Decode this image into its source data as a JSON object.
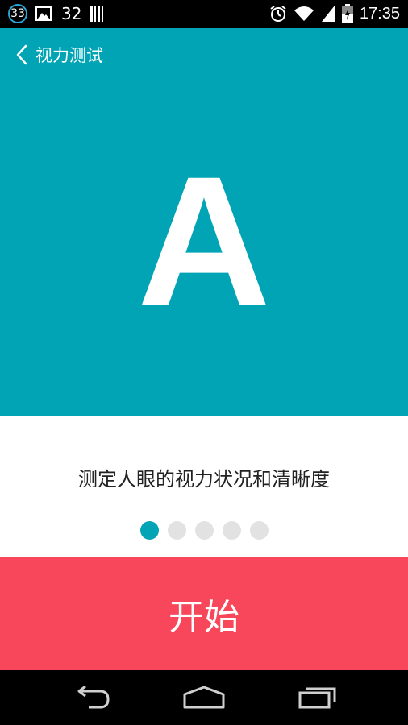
{
  "status_bar": {
    "notification_count": "33",
    "count_label": "32",
    "time": "17:35",
    "icons": [
      "notification-badge-icon",
      "image-icon",
      "barcode-icon",
      "alarm-icon",
      "wifi-icon",
      "signal-icon",
      "battery-icon"
    ]
  },
  "header": {
    "back_icon": "chevron-left-icon",
    "title": "视力测试"
  },
  "hero": {
    "letter": "A",
    "color": "#00a4b5"
  },
  "info": {
    "description": "测定人眼的视力状况和清晰度",
    "pagination": {
      "total": 5,
      "active_index": 0
    }
  },
  "start_button": {
    "label": "开始",
    "color": "#f8475a"
  },
  "nav_bar": {
    "icons": [
      "back-arrow-icon",
      "home-icon",
      "recent-apps-icon"
    ]
  }
}
